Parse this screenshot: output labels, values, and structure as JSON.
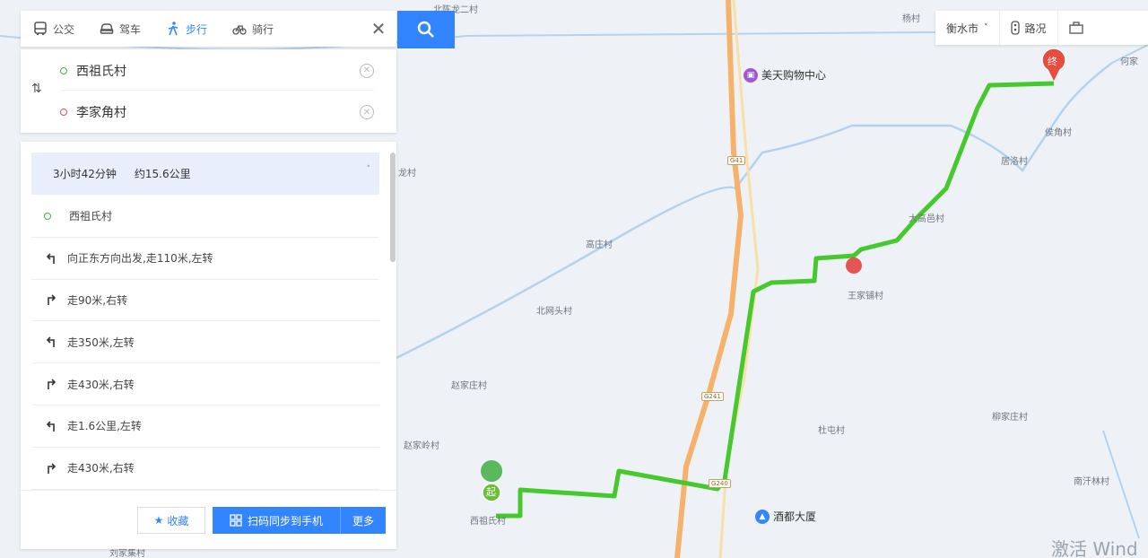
{
  "tabs": [
    {
      "label": "公交",
      "icon": "bus-icon",
      "active": false
    },
    {
      "label": "驾车",
      "icon": "car-icon",
      "active": false
    },
    {
      "label": "步行",
      "icon": "walk-icon",
      "active": true
    },
    {
      "label": "骑行",
      "icon": "bike-icon",
      "active": false
    }
  ],
  "route": {
    "start": "西祖氏村",
    "end": "李家角村"
  },
  "summary": {
    "duration": "3小时42分钟",
    "distance": "约15.6公里"
  },
  "steps": [
    {
      "text": "西祖氏村",
      "icon": "start-dot-icon"
    },
    {
      "text": "向正东方向出发,走110米,左转",
      "icon": "turn-left-icon"
    },
    {
      "text": "走90米,右转",
      "icon": "turn-right-icon"
    },
    {
      "text": "走350米,左转",
      "icon": "turn-left-icon"
    },
    {
      "text": "走430米,右转",
      "icon": "turn-right-icon"
    },
    {
      "text": "走1.6公里,左转",
      "icon": "turn-left-icon"
    },
    {
      "text": "走430米,右转",
      "icon": "turn-right-icon"
    }
  ],
  "footer": {
    "favorite": "收藏",
    "sync": "扫码同步到手机",
    "more": "更多"
  },
  "tools": {
    "city": "衡水市",
    "traffic": "路况"
  },
  "map": {
    "labels": {
      "north_village": "北陈龙二村",
      "yang": "杨村",
      "he": "何家",
      "houjiao": "侯角村",
      "jujiao": "居洛村",
      "dapoyi": "大高邑村",
      "wangjiapu": "王家铺村",
      "gaozhuang": "高庄村",
      "beiwangtou": "北网头村",
      "longcun": "龙村",
      "zhaojiazhuang": "赵家庄村",
      "zhaojialing": "赵家岭村",
      "dutun": "杜屯村",
      "liujiazhuang": "柳家庄村",
      "nanzhuang": "南汗林村",
      "start_village": "西祖氏村",
      "bottom_left": "刘家集村"
    },
    "pois": {
      "mall": "美天购物中心",
      "hotel": "酒都大厦"
    },
    "shields": {
      "top": "G41",
      "middle": "G241",
      "bottom": "G240"
    },
    "markers": {
      "start": "起",
      "end": "终"
    },
    "colors": {
      "route": "#45c92f",
      "highway": "#f6b26b",
      "river": "#b4d2ef"
    }
  },
  "watermark": "激活 Wind"
}
